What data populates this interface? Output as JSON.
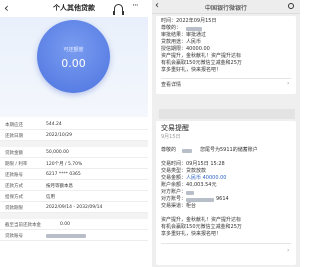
{
  "left": {
    "back_glyph": "‹",
    "title": "个人其他贷款",
    "more_glyph": "···",
    "circle_label": "可还额度",
    "circle_value": "0.00",
    "rows": [
      {
        "label": "本期应还",
        "value": "544.24"
      },
      {
        "label": "还款日期",
        "value": "2022/10/29"
      },
      {
        "label": "贷款金额",
        "value": "50,000.00"
      },
      {
        "label": "期限 / 利率",
        "value": "120个月 / 5.70%"
      },
      {
        "label": "还款账号",
        "value": "6217 **** 0365"
      },
      {
        "label": "还款方式",
        "value": "按月等额本息"
      },
      {
        "label": "担保方式",
        "value": "信用"
      },
      {
        "label": "贷款期限",
        "value": "2022/09/14 - 2032/09/14"
      },
      {
        "label": "截至当前还款本金",
        "value": "0.00"
      },
      {
        "label": "贷款账号",
        "value": ""
      }
    ]
  },
  "right": {
    "back_glyph": "‹",
    "title": "中国银行微银行",
    "card1": {
      "time": "时间：2022年09月15日",
      "lines": [
        "尊敬的：",
        "审批结果：审批通过",
        "贷款用途：人民币",
        "授信期限：40000.00"
      ],
      "notice1": "资产提升，金秋献礼！资产提升达标",
      "notice2": "有机会赢取150元微信立减金和25万",
      "notice3": "享多重好礼，快来报名吧！"
    },
    "link_label": "查看详情",
    "card2": {
      "title": "交易提醒",
      "date": "9月15日",
      "greeting": "尊敬的",
      "acct": "您尾号为5911的储蓄账户",
      "trade_time": "交易时间：09月15日 15:28",
      "trade_type": "交易类型：贷款放款",
      "trade_amount_prefix": "交易金额：",
      "trade_amount": "人民币 40000.00",
      "balance_prefix": "账户余额：",
      "balance": "40,003.54元",
      "payer": "对方账户：",
      "payer_acct": "对方账号：",
      "payer_acct_tail": "9614",
      "channel": "交易渠道：柜台",
      "notice1": "资产提升，金秋献礼！资产提升达标",
      "notice2": "有机会赢取150元微信立减金和25万",
      "notice3": "享多重好礼，快来报名吧！"
    }
  }
}
